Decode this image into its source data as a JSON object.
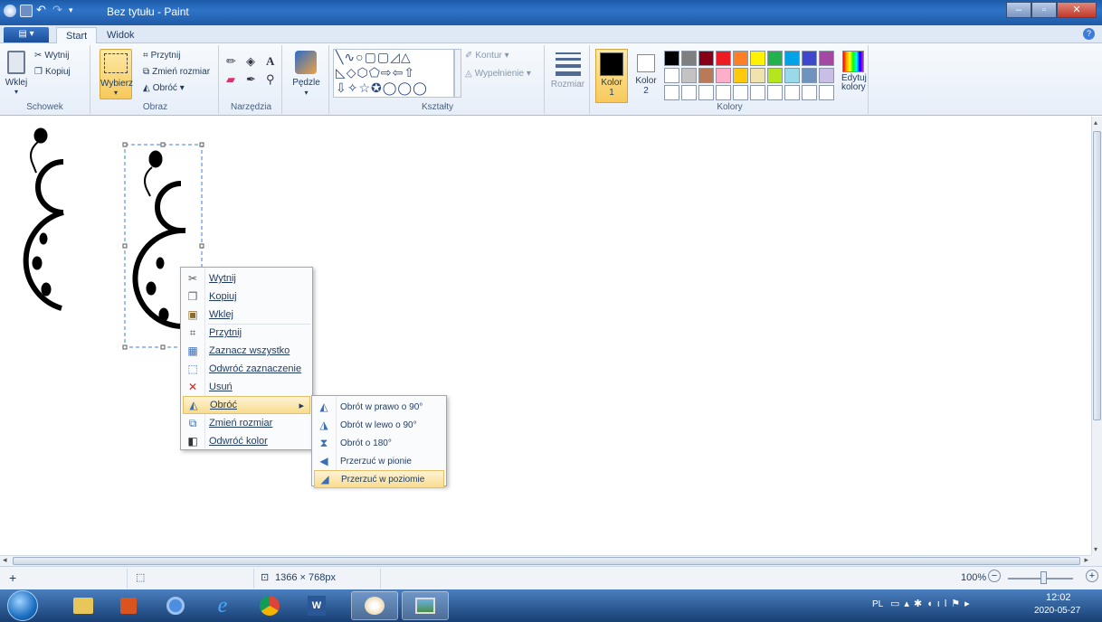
{
  "title_bar": {
    "title": "Bez tytułu - Paint",
    "minimize": "–",
    "maximize": "▫",
    "close": "✕"
  },
  "tabs": {
    "file": "▤ ▾",
    "start": "Start",
    "view": "Widok",
    "help": "?"
  },
  "ribbon": {
    "clipboard": {
      "paste": "Wklej",
      "cut": "Wytnij",
      "copy": "Kopiuj",
      "label": "Schowek"
    },
    "image": {
      "select": "Wybierz",
      "crop": "Przytnij",
      "resize": "Zmień rozmiar",
      "rotate": "Obróć ▾",
      "label": "Obraz"
    },
    "tools": {
      "label": "Narzędzia"
    },
    "brushes": {
      "label": "Pędzle"
    },
    "shapes": {
      "outline": "Kontur ▾",
      "fill": "Wypełnienie ▾",
      "label": "Kształty"
    },
    "size": {
      "label": "Rozmiar"
    },
    "colors": {
      "color1": "Kolor 1",
      "color2": "Kolor 2",
      "edit": "Edytuj kolory",
      "label": "Kolory",
      "row1": [
        "#000000",
        "#7f7f7f",
        "#880015",
        "#ed1c24",
        "#ff7f27",
        "#fff200",
        "#22b14c",
        "#00a2e8",
        "#3f48cc",
        "#a349a4"
      ],
      "row2": [
        "#ffffff",
        "#c3c3c3",
        "#b97a57",
        "#ffaec9",
        "#ffc90e",
        "#efe4b0",
        "#b5e61d",
        "#99d9ea",
        "#7092be",
        "#c8bfe7"
      ]
    }
  },
  "context_menu": {
    "items": [
      "Wytnij",
      "Kopiuj",
      "Wklej",
      "Przytnij",
      "Zaznacz wszystko",
      "Odwróć zaznaczenie",
      "Usuń",
      "Obróć",
      "Zmień rozmiar",
      "Odwróć kolor"
    ]
  },
  "submenu": {
    "items": [
      "Obrót w prawo o 90°",
      "Obrót w lewo o 90°",
      "Obrót o 180°",
      "Przerzuć w pionie",
      "Przerzuć w poziomie"
    ]
  },
  "status": {
    "image_size": "1366 × 768px",
    "zoom": "100%"
  },
  "taskbar": {
    "lang": "PL",
    "time": "12:02",
    "date": "2020-05-27"
  }
}
